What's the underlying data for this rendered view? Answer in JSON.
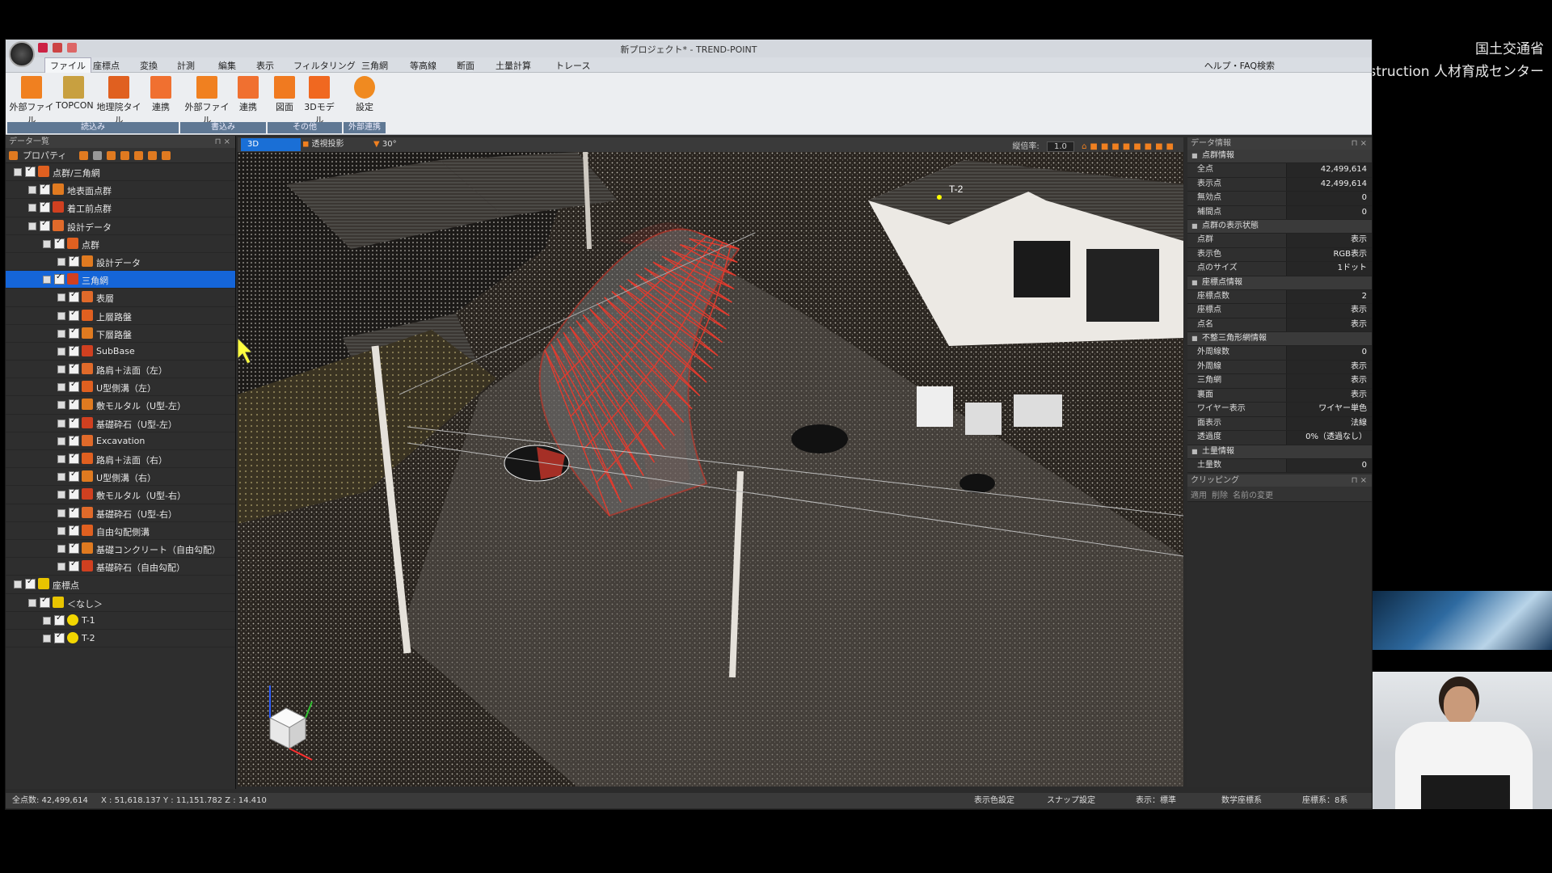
{
  "overlay": {
    "line1": "国土交通省",
    "line2": "関東DX・i-Construction 人材育成センター"
  },
  "app": {
    "title": "新プロジェクト* - TREND-POINT",
    "menu": [
      "ファイル",
      "座標点",
      "変換",
      "計測",
      "編集",
      "表示",
      "フィルタリング",
      "三角網",
      "等高線",
      "断面",
      "土量計算",
      "トレース"
    ],
    "help": "ヘルプ・FAQ検索",
    "ribbon": {
      "buttons": [
        "外部ファイル",
        "TOPCON",
        "地理院タイル",
        "連携",
        "外部ファイル",
        "連携",
        "図面",
        "3Dモデル",
        "設定"
      ],
      "groups": [
        "読込み",
        "書込み",
        "その他",
        "外部連携"
      ]
    }
  },
  "left_panel": {
    "title": "データ一覧",
    "toolbar_label": "プロパティ",
    "tree": [
      {
        "label": "点群/三角網",
        "level": 0
      },
      {
        "label": "地表面点群",
        "level": 1
      },
      {
        "label": "着工前点群",
        "level": 1
      },
      {
        "label": "設計データ",
        "level": 1
      },
      {
        "label": "点群",
        "level": 2
      },
      {
        "label": "設計データ",
        "level": 3
      },
      {
        "label": "三角網",
        "level": 2
      },
      {
        "label": "表層",
        "level": 3
      },
      {
        "label": "上層路盤",
        "level": 3
      },
      {
        "label": "下層路盤",
        "level": 3
      },
      {
        "label": "SubBase",
        "level": 3
      },
      {
        "label": "路肩＋法面（左）",
        "level": 3
      },
      {
        "label": "U型側溝（左）",
        "level": 3
      },
      {
        "label": "敷モルタル（U型-左）",
        "level": 3
      },
      {
        "label": "基礎砕石（U型-左）",
        "level": 3
      },
      {
        "label": "Excavation",
        "level": 3
      },
      {
        "label": "路肩＋法面（右）",
        "level": 3
      },
      {
        "label": "U型側溝（右）",
        "level": 3
      },
      {
        "label": "敷モルタル（U型-右）",
        "level": 3
      },
      {
        "label": "基礎砕石（U型-右）",
        "level": 3
      },
      {
        "label": "自由勾配側溝",
        "level": 3
      },
      {
        "label": "基礎コンクリート（自由勾配）",
        "level": 3
      },
      {
        "label": "基礎砕石（自由勾配）",
        "level": 3
      },
      {
        "label": "座標点",
        "level": 0
      },
      {
        "label": "＜なし＞",
        "level": 1
      },
      {
        "label": "T-1",
        "level": 2
      },
      {
        "label": "T-2",
        "level": 2
      }
    ]
  },
  "viewport": {
    "tabs": [
      "3D",
      "透視投影",
      "30°"
    ],
    "zoom_label": "縦倍率:",
    "zoom_value": "1.0",
    "marker_label": "T-2"
  },
  "right_panel": {
    "title": "データ情報",
    "sections": [
      {
        "title": "点群情報",
        "rows": [
          [
            "全点",
            "42,499,614"
          ],
          [
            "表示点",
            "42,499,614"
          ],
          [
            "無効点",
            "0"
          ],
          [
            "補間点",
            "0"
          ]
        ]
      },
      {
        "title": "点群の表示状態",
        "rows": [
          [
            "点群",
            "表示"
          ],
          [
            "表示色",
            "RGB表示"
          ],
          [
            "点のサイズ",
            "1ドット"
          ]
        ]
      },
      {
        "title": "座標点情報",
        "rows": [
          [
            "座標点数",
            "2"
          ],
          [
            "座標点",
            "表示"
          ],
          [
            "点名",
            "表示"
          ]
        ]
      },
      {
        "title": "不整三角形網情報",
        "rows": [
          [
            "外周線数",
            "0"
          ],
          [
            "外周線",
            "表示"
          ],
          [
            "三角網",
            "表示"
          ],
          [
            "裏面",
            "表示"
          ],
          [
            "ワイヤー表示",
            "ワイヤー単色"
          ],
          [
            "面表示",
            "法線"
          ],
          [
            "透過度",
            "0%（透過なし）"
          ]
        ]
      },
      {
        "title": "土量情報",
        "rows": [
          [
            "土量数",
            "0"
          ]
        ]
      }
    ],
    "clipping_title": "クリッピング",
    "clipping_tools": [
      "適用",
      "削除",
      "名前の変更"
    ]
  },
  "status": {
    "total_points": "全点数: 42,499,614",
    "coords": "X : 51,618.137  Y : 11,151.782  Z : 14.410",
    "right_items": [
      "表示色設定",
      "スナップ設定",
      "表示：標準",
      "数学座標系",
      "座標系：8系"
    ]
  },
  "colors": {
    "accent": "#1565d8",
    "mesh": "#e23b2e",
    "ribbon_icon": "#f08020"
  }
}
